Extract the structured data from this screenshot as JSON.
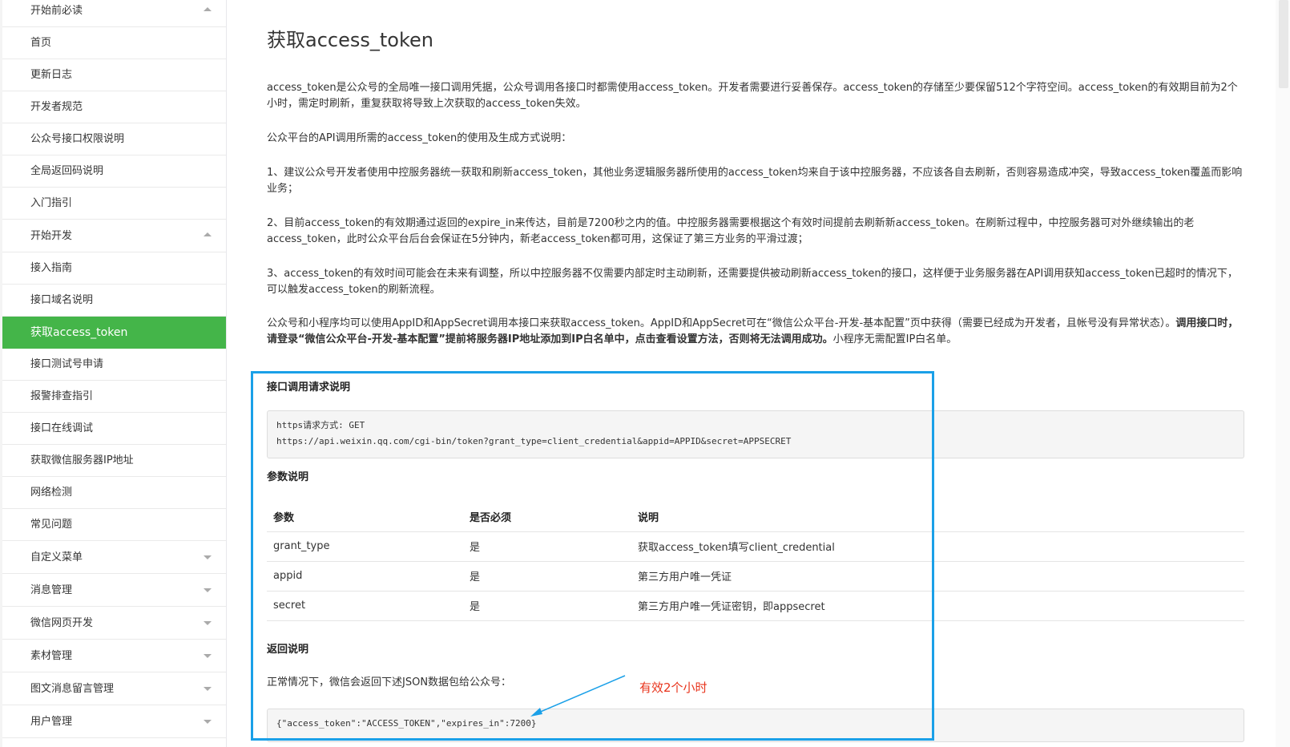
{
  "sidebar": {
    "items": [
      {
        "label": "开始前必读",
        "kind": "group",
        "caret": "up"
      },
      {
        "label": "首页",
        "kind": "item"
      },
      {
        "label": "更新日志",
        "kind": "item"
      },
      {
        "label": "开发者规范",
        "kind": "item"
      },
      {
        "label": "公众号接口权限说明",
        "kind": "item"
      },
      {
        "label": "全局返回码说明",
        "kind": "item"
      },
      {
        "label": "入门指引",
        "kind": "item"
      },
      {
        "label": "开始开发",
        "kind": "group",
        "caret": "up"
      },
      {
        "label": "接入指南",
        "kind": "item"
      },
      {
        "label": "接口域名说明",
        "kind": "item"
      },
      {
        "label": "获取access_token",
        "kind": "item",
        "active": true
      },
      {
        "label": "接口测试号申请",
        "kind": "item"
      },
      {
        "label": "报警排查指引",
        "kind": "item"
      },
      {
        "label": "接口在线调试",
        "kind": "item"
      },
      {
        "label": "获取微信服务器IP地址",
        "kind": "item"
      },
      {
        "label": "网络检测",
        "kind": "item"
      },
      {
        "label": "常见问题",
        "kind": "item"
      },
      {
        "label": "自定义菜单",
        "kind": "group",
        "caret": "down"
      },
      {
        "label": "消息管理",
        "kind": "group",
        "caret": "down"
      },
      {
        "label": "微信网页开发",
        "kind": "group",
        "caret": "down"
      },
      {
        "label": "素材管理",
        "kind": "group",
        "caret": "down"
      },
      {
        "label": "图文消息留言管理",
        "kind": "group",
        "caret": "down"
      },
      {
        "label": "用户管理",
        "kind": "group",
        "caret": "down"
      }
    ]
  },
  "main": {
    "title": "获取access_token",
    "p1": "access_token是公众号的全局唯一接口调用凭据，公众号调用各接口时都需使用access_token。开发者需要进行妥善保存。access_token的存储至少要保留512个字符空间。access_token的有效期目前为2个小时，需定时刷新，重复获取将导致上次获取的access_token失效。",
    "p2": "公众平台的API调用所需的access_token的使用及生成方式说明：",
    "p3": "1、建议公众号开发者使用中控服务器统一获取和刷新access_token，其他业务逻辑服务器所使用的access_token均来自于该中控服务器，不应该各自去刷新，否则容易造成冲突，导致access_token覆盖而影响业务；",
    "p4": "2、目前access_token的有效期通过返回的expire_in来传达，目前是7200秒之内的值。中控服务器需要根据这个有效时间提前去刷新新access_token。在刷新过程中，中控服务器可对外继续输出的老access_token，此时公众平台后台会保证在5分钟内，新老access_token都可用，这保证了第三方业务的平滑过渡；",
    "p5": "3、access_token的有效时间可能会在未来有调整，所以中控服务器不仅需要内部定时主动刷新，还需要提供被动刷新access_token的接口，这样便于业务服务器在API调用获知access_token已超时的情况下，可以触发access_token的刷新流程。",
    "p6_a": "公众号和小程序均可以使用AppID和AppSecret调用本接口来获取access_token。AppID和AppSecret可在“微信公众平台-开发-基本配置”页中获得（需要已经成为开发者，且帐号没有异常状态）。",
    "p6_b": "调用接口时，请登录“微信公众平台-开发-基本配置”提前将服务器IP地址添加到IP白名单中，点击查看设置方法，否则将无法调用成功。",
    "p6_c": "小程序无需配置IP白名单。",
    "request_title": "接口调用请求说明",
    "request_line1": "https请求方式: GET",
    "request_line2": "https://api.weixin.qq.com/cgi-bin/token?grant_type=client_credential&appid=APPID&secret=APPSECRET",
    "params_title": "参数说明",
    "table": {
      "headers": [
        "参数",
        "是否必须",
        "说明"
      ],
      "rows": [
        [
          "grant_type",
          "是",
          "获取access_token填写client_credential"
        ],
        [
          "appid",
          "是",
          "第三方用户唯一凭证"
        ],
        [
          "secret",
          "是",
          "第三方用户唯一凭证密钥，即appsecret"
        ]
      ]
    },
    "return_title": "返回说明",
    "return_desc": "正常情况下，微信会返回下述JSON数据包给公众号：",
    "return_json": "{\"access_token\":\"ACCESS_TOKEN\",\"expires_in\":7200}",
    "annotation": "有效2个小时"
  },
  "colors": {
    "active_bg": "#44b549",
    "highlight_border": "#1aa0e8",
    "annotation": "#e8341c"
  }
}
